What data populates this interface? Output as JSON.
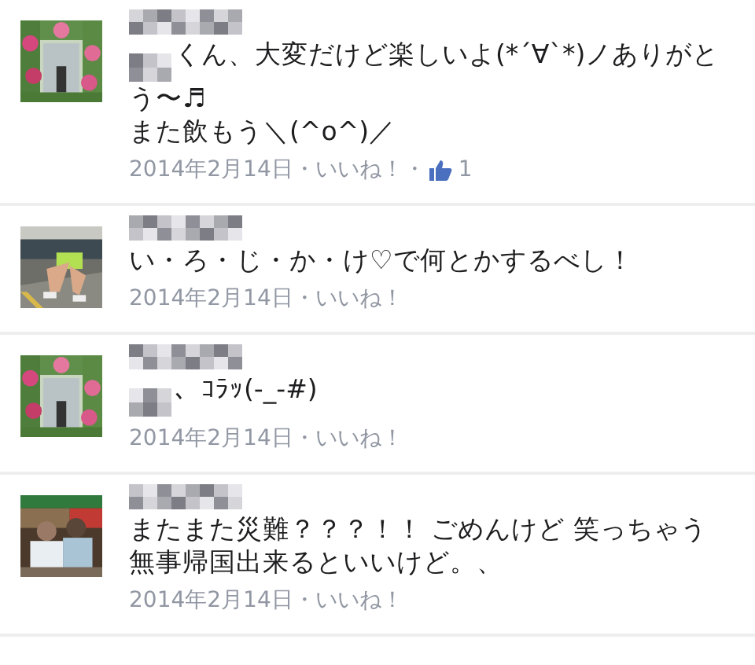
{
  "comments": [
    {
      "name_blurred": true,
      "text_blurred_start": true,
      "text": "くん、大変だけど楽しいよ(*´∀`*)ノありがとう〜♬\nまた飲もう＼(^o^)／",
      "date": "2014年2月14日",
      "separator": "・",
      "like_link": "いいね！",
      "like_count": "1"
    },
    {
      "name_blurred": true,
      "text_blurred_start": false,
      "text": "い・ろ・じ・か・け♡で何とかするべし！",
      "date": "2014年2月14日",
      "separator": "・",
      "like_link": "いいね！"
    },
    {
      "name_blurred": true,
      "text_blurred_start": true,
      "text": "、ｺﾗｯ(-_-#)",
      "date": "2014年2月14日",
      "separator": "・",
      "like_link": "いいね！"
    },
    {
      "name_blurred": true,
      "text_blurred_start": false,
      "text": "またまた災難？？？！！ ごめんけど 笑っちゃう無事帰国出来るといいけど。、",
      "date": "2014年2月14日",
      "separator": "・",
      "like_link": "いいね！"
    }
  ]
}
